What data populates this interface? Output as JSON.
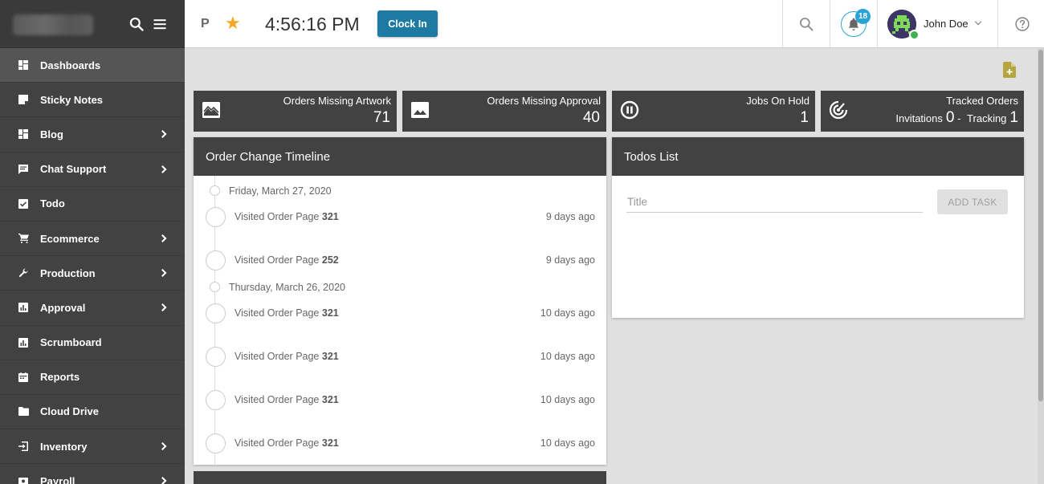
{
  "sidebar": {
    "items": [
      {
        "label": "Dashboards",
        "icon": "dashboard-icon",
        "chevron": false,
        "active": true
      },
      {
        "label": "Sticky Notes",
        "icon": "note-icon",
        "chevron": false
      },
      {
        "label": "Blog",
        "icon": "dashboard-icon",
        "chevron": true
      },
      {
        "label": "Chat Support",
        "icon": "chat-icon",
        "chevron": true
      },
      {
        "label": "Todo",
        "icon": "checkbox-icon",
        "chevron": false
      },
      {
        "label": "Ecommerce",
        "icon": "cart-icon",
        "chevron": true
      },
      {
        "label": "Production",
        "icon": "wrench-icon",
        "chevron": true
      },
      {
        "label": "Approval",
        "icon": "chart-icon",
        "chevron": true
      },
      {
        "label": "Scrumboard",
        "icon": "chart-icon",
        "chevron": false
      },
      {
        "label": "Reports",
        "icon": "calendar-icon",
        "chevron": false
      },
      {
        "label": "Cloud Drive",
        "icon": "folder-icon",
        "chevron": false
      },
      {
        "label": "Inventory",
        "icon": "import-icon",
        "chevron": true
      },
      {
        "label": "Payroll",
        "icon": "payroll-icon",
        "chevron": true
      }
    ]
  },
  "header": {
    "p_label": "P",
    "time": "4:56:16 PM",
    "clock_in": "Clock In",
    "notifications": "18",
    "user_name": "John Doe"
  },
  "stats": [
    {
      "title": "Orders Missing Artwork",
      "value": "71",
      "icon": "artwork-icon"
    },
    {
      "title": "Orders Missing Approval",
      "value": "40",
      "icon": "image-icon"
    },
    {
      "title": "Jobs On Hold",
      "value": "1",
      "icon": "pause-icon"
    },
    {
      "title": "Tracked Orders",
      "icon": "radar-icon",
      "invitations_label": "Invitations",
      "invitations": "0",
      "sep": " - ",
      "tracking_label": "Tracking",
      "tracking": "1"
    }
  ],
  "timeline": {
    "title": "Order Change Timeline",
    "groups": [
      {
        "date": "Friday, March 27, 2020",
        "entries": [
          {
            "text": "Visited Order Page",
            "order": "321",
            "time": "9 days ago"
          },
          {
            "text": "Visited Order Page",
            "order": "252",
            "time": "9 days ago"
          }
        ]
      },
      {
        "date": "Thursday, March 26, 2020",
        "entries": [
          {
            "text": "Visited Order Page",
            "order": "321",
            "time": "10 days ago"
          },
          {
            "text": "Visited Order Page",
            "order": "321",
            "time": "10 days ago"
          },
          {
            "text": "Visited Order Page",
            "order": "321",
            "time": "10 days ago"
          },
          {
            "text": "Visited Order Page",
            "order": "321",
            "time": "10 days ago"
          }
        ]
      }
    ]
  },
  "todos": {
    "title": "Todos List",
    "placeholder": "Title",
    "value": "",
    "add_button": "ADD TASK"
  },
  "colors": {
    "sidebar": "#424242",
    "accent": "#1c7aa3",
    "badge": "#29a3d6",
    "star": "#f5a623"
  }
}
